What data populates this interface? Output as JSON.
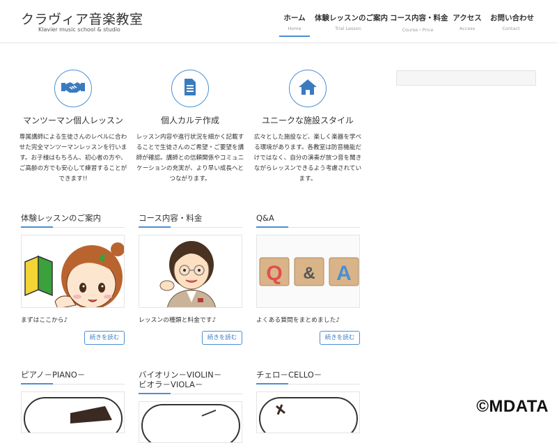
{
  "site": {
    "title": "クラヴィア音楽教室",
    "subtitle": "Klavier music school & studio"
  },
  "nav": {
    "items": [
      {
        "jp": "ホーム",
        "en": "Home"
      },
      {
        "jp": "体験レッスンのご案内",
        "en": "Trial Lesson"
      },
      {
        "jp": "コース内容・料金",
        "en": "Course・Price"
      },
      {
        "jp": "アクセス",
        "en": "Access"
      },
      {
        "jp": "お問い合わせ",
        "en": "Contact"
      }
    ]
  },
  "features": [
    {
      "icon": "handshake-icon",
      "title": "マンツーマン個人レッスン",
      "desc": "専属講師による生徒さんのレベルに合わせた完全マンツーマンレッスンを行います。お子様はもちろん、初心者の方や、ご高齢の方でも安心して練習することができます!!"
    },
    {
      "icon": "document-icon",
      "title": "個人カルテ作成",
      "desc": "レッスン内容や進行状況を細かく記載することで生徒さんのご希望・ご要望を講師が確認。講師との信頼関係やコミュニケーションの充実が、より早い成長へとつながります。"
    },
    {
      "icon": "home-icon",
      "title": "ユニークな施設スタイル",
      "desc": "広々とした施設など、楽しく楽器を学べる環境があります。各教室は防音機能だけではなく、自分の演奏が放つ音を聞きながらレッスンできるよう考慮されています。"
    }
  ],
  "cards": [
    {
      "title": "体験レッスンのご案内",
      "text": "まずはここから♪",
      "button": "続きを読む"
    },
    {
      "title": "コース内容・料金",
      "text": "レッスンの種類と料金です♪",
      "button": "続きを読む"
    },
    {
      "title": "Q&A",
      "text": "よくある質問をまとめました♪",
      "button": "続きを読む",
      "blocks": [
        "Q",
        "&",
        "A"
      ]
    }
  ],
  "cards2": [
    {
      "title": "ピアノ－PIANO－"
    },
    {
      "title": "バイオリン－VIOLIN－\nビオラ－VIOLA－"
    },
    {
      "title": "チェロ－CELLO－"
    }
  ],
  "watermark": "©MDATA",
  "colors": {
    "accent": "#4a8fd4",
    "button_text": "#3a7bc0"
  }
}
